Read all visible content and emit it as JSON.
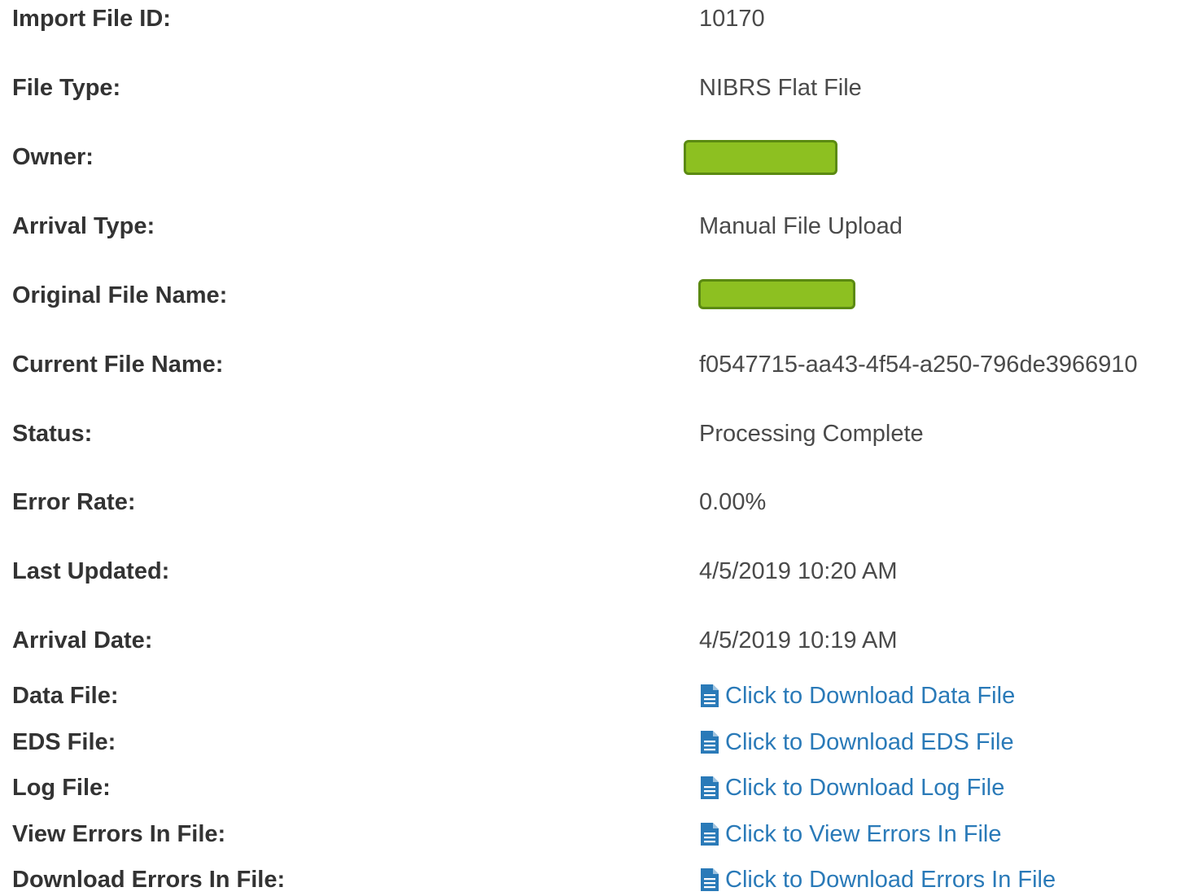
{
  "theme": {
    "link_color": "#2a7ab8",
    "redaction_fill": "#8dc021",
    "label_color": "#333333",
    "value_color": "#4a4a4a"
  },
  "fields": {
    "import_file_id": {
      "label": "Import File ID:",
      "value": "10170"
    },
    "file_type": {
      "label": "File Type:",
      "value": "NIBRS Flat File"
    },
    "owner": {
      "label": "Owner:"
    },
    "arrival_type": {
      "label": "Arrival Type:",
      "value": "Manual File Upload"
    },
    "original_file_name": {
      "label": "Original File Name:"
    },
    "current_file_name": {
      "label": "Current File Name:",
      "value": "f0547715-aa43-4f54-a250-796de3966910"
    },
    "status": {
      "label": "Status:",
      "value": "Processing Complete"
    },
    "error_rate": {
      "label": "Error Rate:",
      "value": "0.00%"
    },
    "last_updated": {
      "label": "Last Updated:",
      "value": "4/5/2019 10:20 AM"
    },
    "arrival_date": {
      "label": "Arrival Date:",
      "value": "4/5/2019 10:19 AM"
    }
  },
  "files": {
    "data_file": {
      "label": "Data File:",
      "link": "Click to Download Data File",
      "icon": "file-text-icon"
    },
    "eds_file": {
      "label": "EDS File:",
      "link": "Click to Download EDS File",
      "icon": "file-text-icon"
    },
    "log_file": {
      "label": "Log File:",
      "link": "Click to Download Log File",
      "icon": "file-text-icon"
    },
    "view_errors": {
      "label": "View Errors In File:",
      "link": "Click to View Errors In File",
      "icon": "file-text-icon"
    },
    "download_errors": {
      "label": "Download Errors In File:",
      "link": "Click to Download Errors In File",
      "icon": "file-text-icon"
    }
  }
}
